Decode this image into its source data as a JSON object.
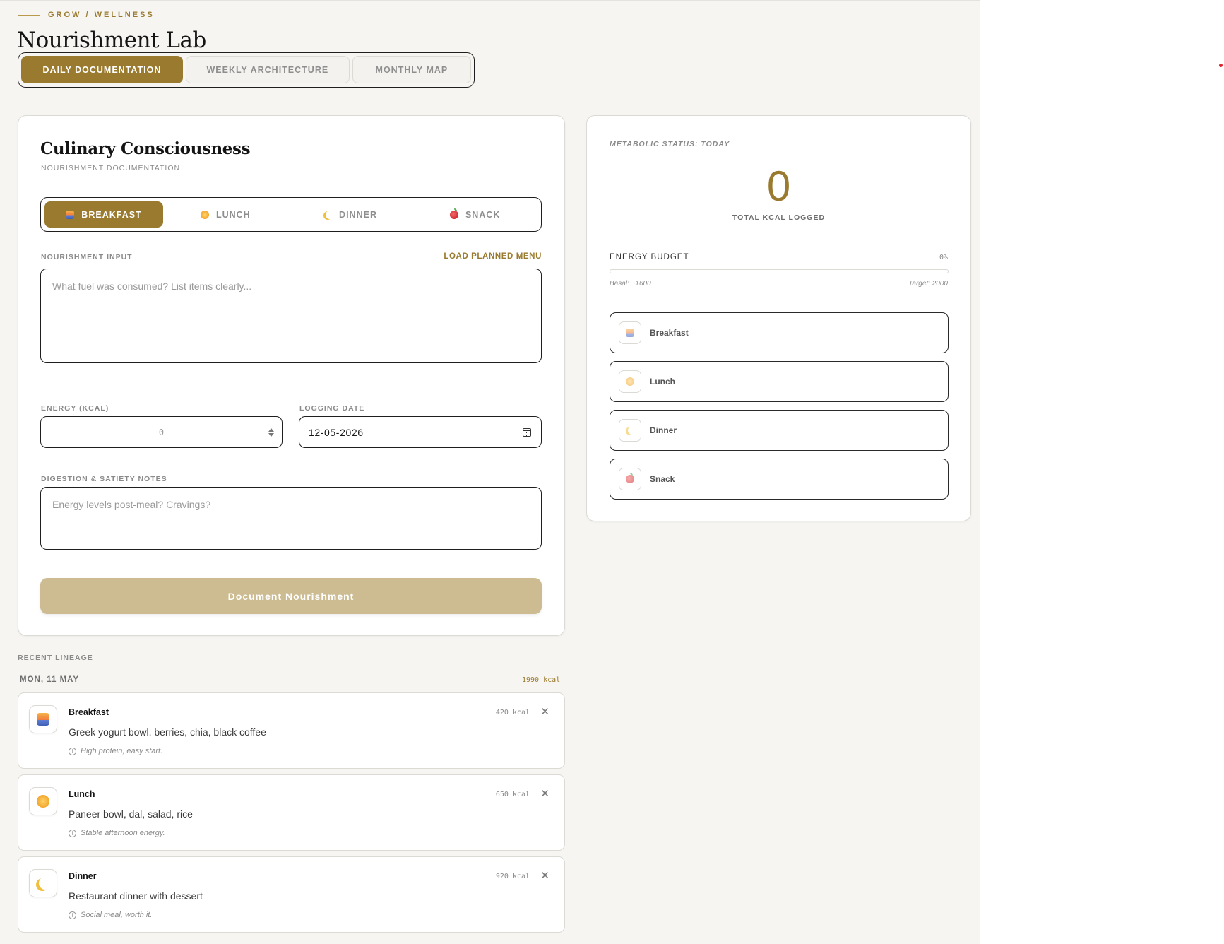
{
  "header": {
    "breadcrumb": "GROW / WELLNESS",
    "title": "Nourishment Lab"
  },
  "view_tabs": [
    {
      "label": "DAILY DOCUMENTATION",
      "active": true
    },
    {
      "label": "WEEKLY ARCHITECTURE",
      "active": false
    },
    {
      "label": "MONTHLY MAP",
      "active": false
    }
  ],
  "form": {
    "title": "Culinary Consciousness",
    "subtitle": "NOURISHMENT DOCUMENTATION",
    "meal_tabs": [
      {
        "label": "BREAKFAST",
        "icon": "sunrise-icon",
        "active": true
      },
      {
        "label": "LUNCH",
        "icon": "sun-icon",
        "active": false
      },
      {
        "label": "DINNER",
        "icon": "moon-icon",
        "active": false
      },
      {
        "label": "SNACK",
        "icon": "apple-icon",
        "active": false
      }
    ],
    "input_label": "NOURISHMENT INPUT",
    "load_planned": "LOAD PLANNED MENU",
    "input_placeholder": "What fuel was consumed? List items clearly...",
    "energy_label": "ENERGY (KCAL)",
    "energy_value": "0",
    "date_label": "LOGGING DATE",
    "date_value": "12-05-2026",
    "notes_label": "DIGESTION & SATIETY NOTES",
    "notes_placeholder": "Energy levels post-meal? Cravings?",
    "submit_label": "Document Nourishment"
  },
  "status": {
    "label": "METABOLIC STATUS: TODAY",
    "total_kcal": "0",
    "total_label": "TOTAL KCAL LOGGED",
    "budget_label": "ENERGY BUDGET",
    "budget_pct": "0%",
    "budget_fraction": 0,
    "basal_note": "Basal: ~1600",
    "target_note": "Target: 2000",
    "meals": [
      {
        "name": "Breakfast",
        "icon": "sunrise-icon"
      },
      {
        "name": "Lunch",
        "icon": "sun-icon"
      },
      {
        "name": "Dinner",
        "icon": "moon-icon"
      },
      {
        "name": "Snack",
        "icon": "apple-icon"
      }
    ]
  },
  "recent": {
    "label": "RECENT LINEAGE",
    "day": "MON, 11 MAY",
    "day_total": "1990 kcal",
    "entries": [
      {
        "meal": "Breakfast",
        "icon": "sunrise-icon",
        "desc": "Greek yogurt bowl, berries, chia, black coffee",
        "note": "High protein, easy start.",
        "kcal": "420 kcal"
      },
      {
        "meal": "Lunch",
        "icon": "sun-icon",
        "desc": "Paneer bowl, dal, salad, rice",
        "note": "Stable afternoon energy.",
        "kcal": "650 kcal"
      },
      {
        "meal": "Dinner",
        "icon": "moon-icon",
        "desc": "Restaurant dinner with dessert",
        "note": "Social meal, worth it.",
        "kcal": "920 kcal"
      }
    ]
  },
  "colors": {
    "accent": "#9a7a2e",
    "accent_muted": "#cdbc91",
    "background": "#f6f5f2"
  }
}
